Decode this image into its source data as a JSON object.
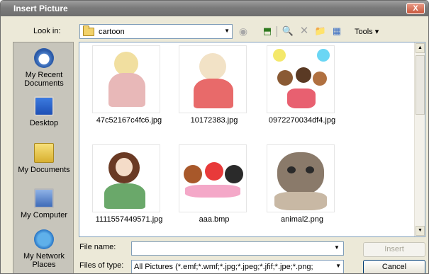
{
  "window": {
    "title": "Insert Picture",
    "close_label": "X"
  },
  "toolbar": {
    "look_in_label": "Look in:",
    "look_in_value": "cartoon",
    "back_glyph": "◉",
    "up_glyph": "⬒",
    "search_glyph": "🔍",
    "delete_glyph": "✕",
    "new_folder_glyph": "📁",
    "views_glyph": "▦",
    "tools_label": "Tools ▾"
  },
  "places": [
    {
      "label": "My Recent Documents",
      "icon": "recent-documents-icon"
    },
    {
      "label": "Desktop",
      "icon": "desktop-icon"
    },
    {
      "label": "My Documents",
      "icon": "my-documents-icon"
    },
    {
      "label": "My Computer",
      "icon": "my-computer-icon"
    },
    {
      "label": "My Network Places",
      "icon": "network-places-icon"
    }
  ],
  "files": [
    {
      "name": "47c52167c4fc6.jpg"
    },
    {
      "name": "10172383.jpg"
    },
    {
      "name": "0972270034df4.jpg"
    },
    {
      "name": "1111557449571.jpg"
    },
    {
      "name": "aaa.bmp"
    },
    {
      "name": "animal2.png"
    }
  ],
  "form": {
    "file_name_label": "File name:",
    "file_name_value": "",
    "files_of_type_label": "Files of type:",
    "files_of_type_value": "All Pictures (*.emf;*.wmf;*.jpg;*.jpeg;*.jfif;*.jpe;*.png;"
  },
  "buttons": {
    "insert": "Insert",
    "cancel": "Cancel"
  }
}
